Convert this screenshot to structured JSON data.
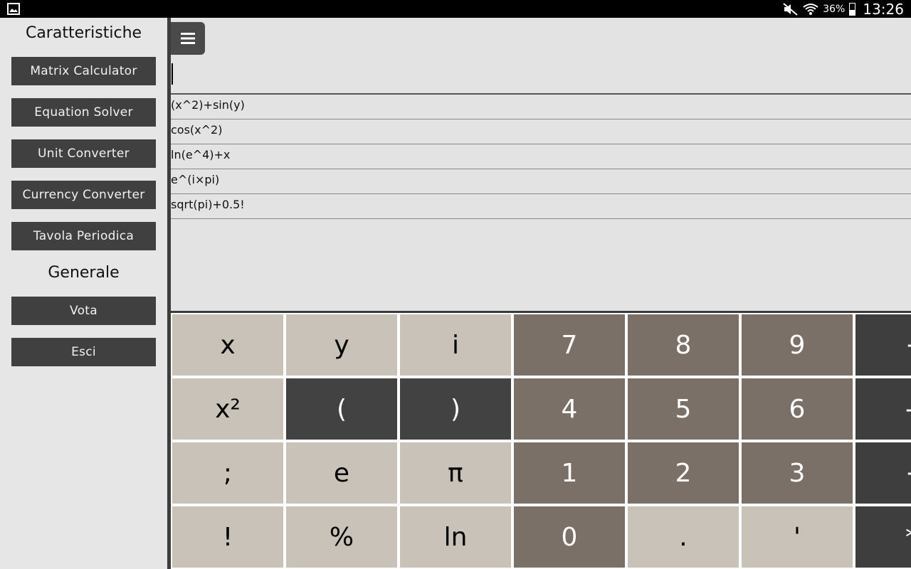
{
  "status_bar": {
    "battery": "36%",
    "time": "13:26"
  },
  "sidebar": {
    "features_title": "Caratteristiche",
    "features": [
      {
        "label": "Matrix Calculator"
      },
      {
        "label": "Equation Solver"
      },
      {
        "label": "Unit Converter"
      },
      {
        "label": "Currency Converter"
      },
      {
        "label": "Tavola Periodica"
      }
    ],
    "general_title": "Generale",
    "general": [
      {
        "label": "Vota"
      },
      {
        "label": "Esci"
      }
    ]
  },
  "main": {
    "input_value": "",
    "history": [
      {
        "expr": "(x^2)+sin(y)"
      },
      {
        "expr": "cos(x^2)"
      },
      {
        "expr": "ln(e^4)+x"
      },
      {
        "expr": "e^(i×pi)"
      },
      {
        "expr": "sqrt(pi)+0.5!"
      }
    ]
  },
  "keypad": {
    "rows": [
      [
        "x",
        "y",
        "i",
        "7",
        "8",
        "9",
        "+"
      ],
      [
        "x²",
        "(",
        ")",
        "4",
        "5",
        "6",
        "-"
      ],
      [
        ";",
        "e",
        "π",
        "1",
        "2",
        "3",
        "÷"
      ],
      [
        "!",
        "%",
        "ln",
        "0",
        ".",
        "'",
        "*"
      ]
    ]
  }
}
